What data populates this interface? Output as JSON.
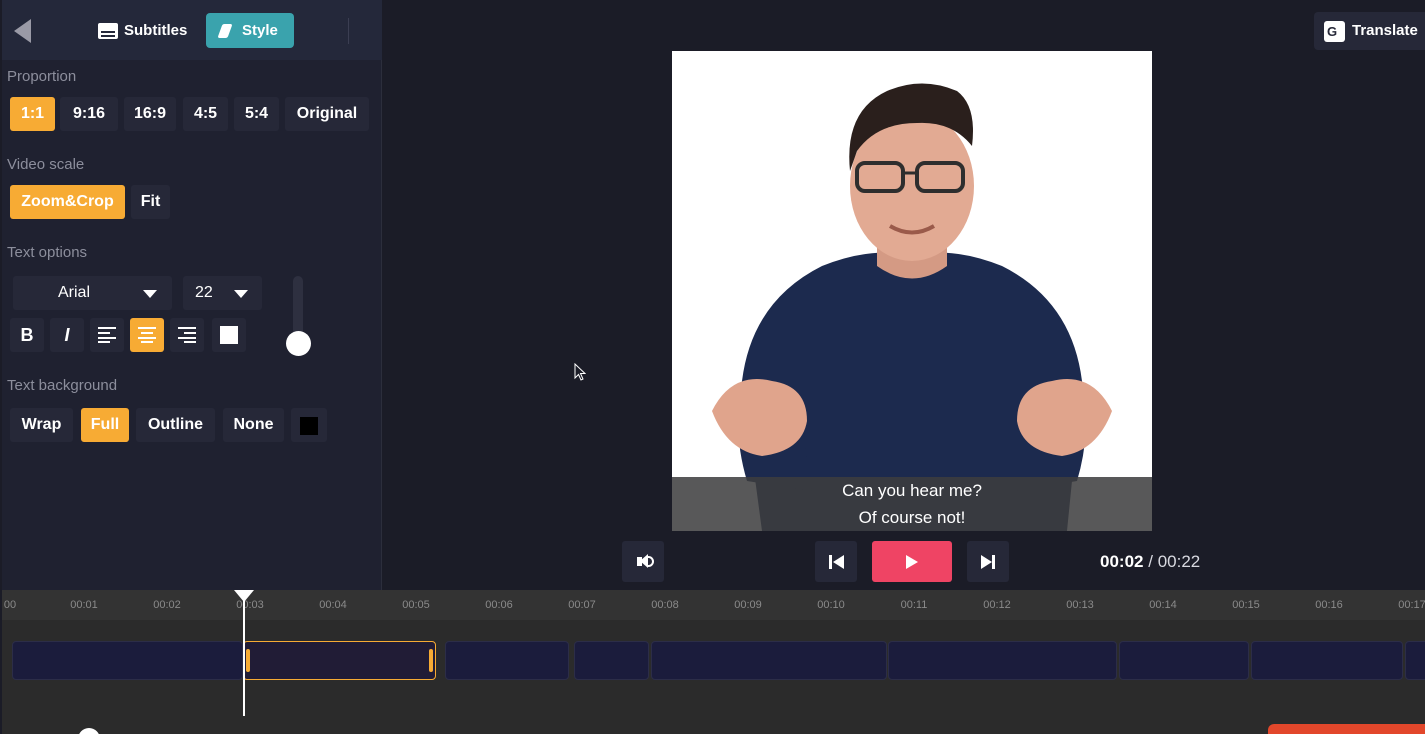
{
  "header": {
    "tabs": [
      {
        "label": "Subtitles",
        "icon": "subtitles-icon",
        "active": false
      },
      {
        "label": "Style",
        "icon": "style-icon",
        "active": true
      }
    ],
    "translate_label": "Translate",
    "accent_color": "#3aa3ad"
  },
  "style_panel": {
    "proportion": {
      "label": "Proportion",
      "options": [
        "1:1",
        "9:16",
        "16:9",
        "4:5",
        "5:4",
        "Original"
      ],
      "selected": "1:1"
    },
    "video_scale": {
      "label": "Video scale",
      "options": [
        "Zoom&Crop",
        "Fit"
      ],
      "selected": "Zoom&Crop"
    },
    "text_options": {
      "label": "Text options",
      "font": "Arial",
      "size": "22",
      "bold_label": "B",
      "italic_label": "I",
      "align_selected": "center",
      "text_color": "#ffffff"
    },
    "text_background": {
      "label": "Text background",
      "options": [
        "Wrap",
        "Full",
        "Outline",
        "None"
      ],
      "selected": "Full",
      "bg_color": "#000000"
    },
    "highlight_color": "#f7ab34"
  },
  "preview": {
    "subtitle_line1": "Can you hear me?",
    "subtitle_line2": "Of course not!"
  },
  "player": {
    "current_time": "00:02",
    "separator": "/",
    "total_time": "00:22",
    "play_color": "#ef4464"
  },
  "timeline": {
    "ticks": [
      "00",
      "00:01",
      "00:02",
      "00:03",
      "00:04",
      "00:05",
      "00:06",
      "00:07",
      "00:08",
      "00:09",
      "00:10",
      "00:11",
      "00:12",
      "00:13",
      "00:14",
      "00:15",
      "00:16",
      "00:17"
    ]
  }
}
